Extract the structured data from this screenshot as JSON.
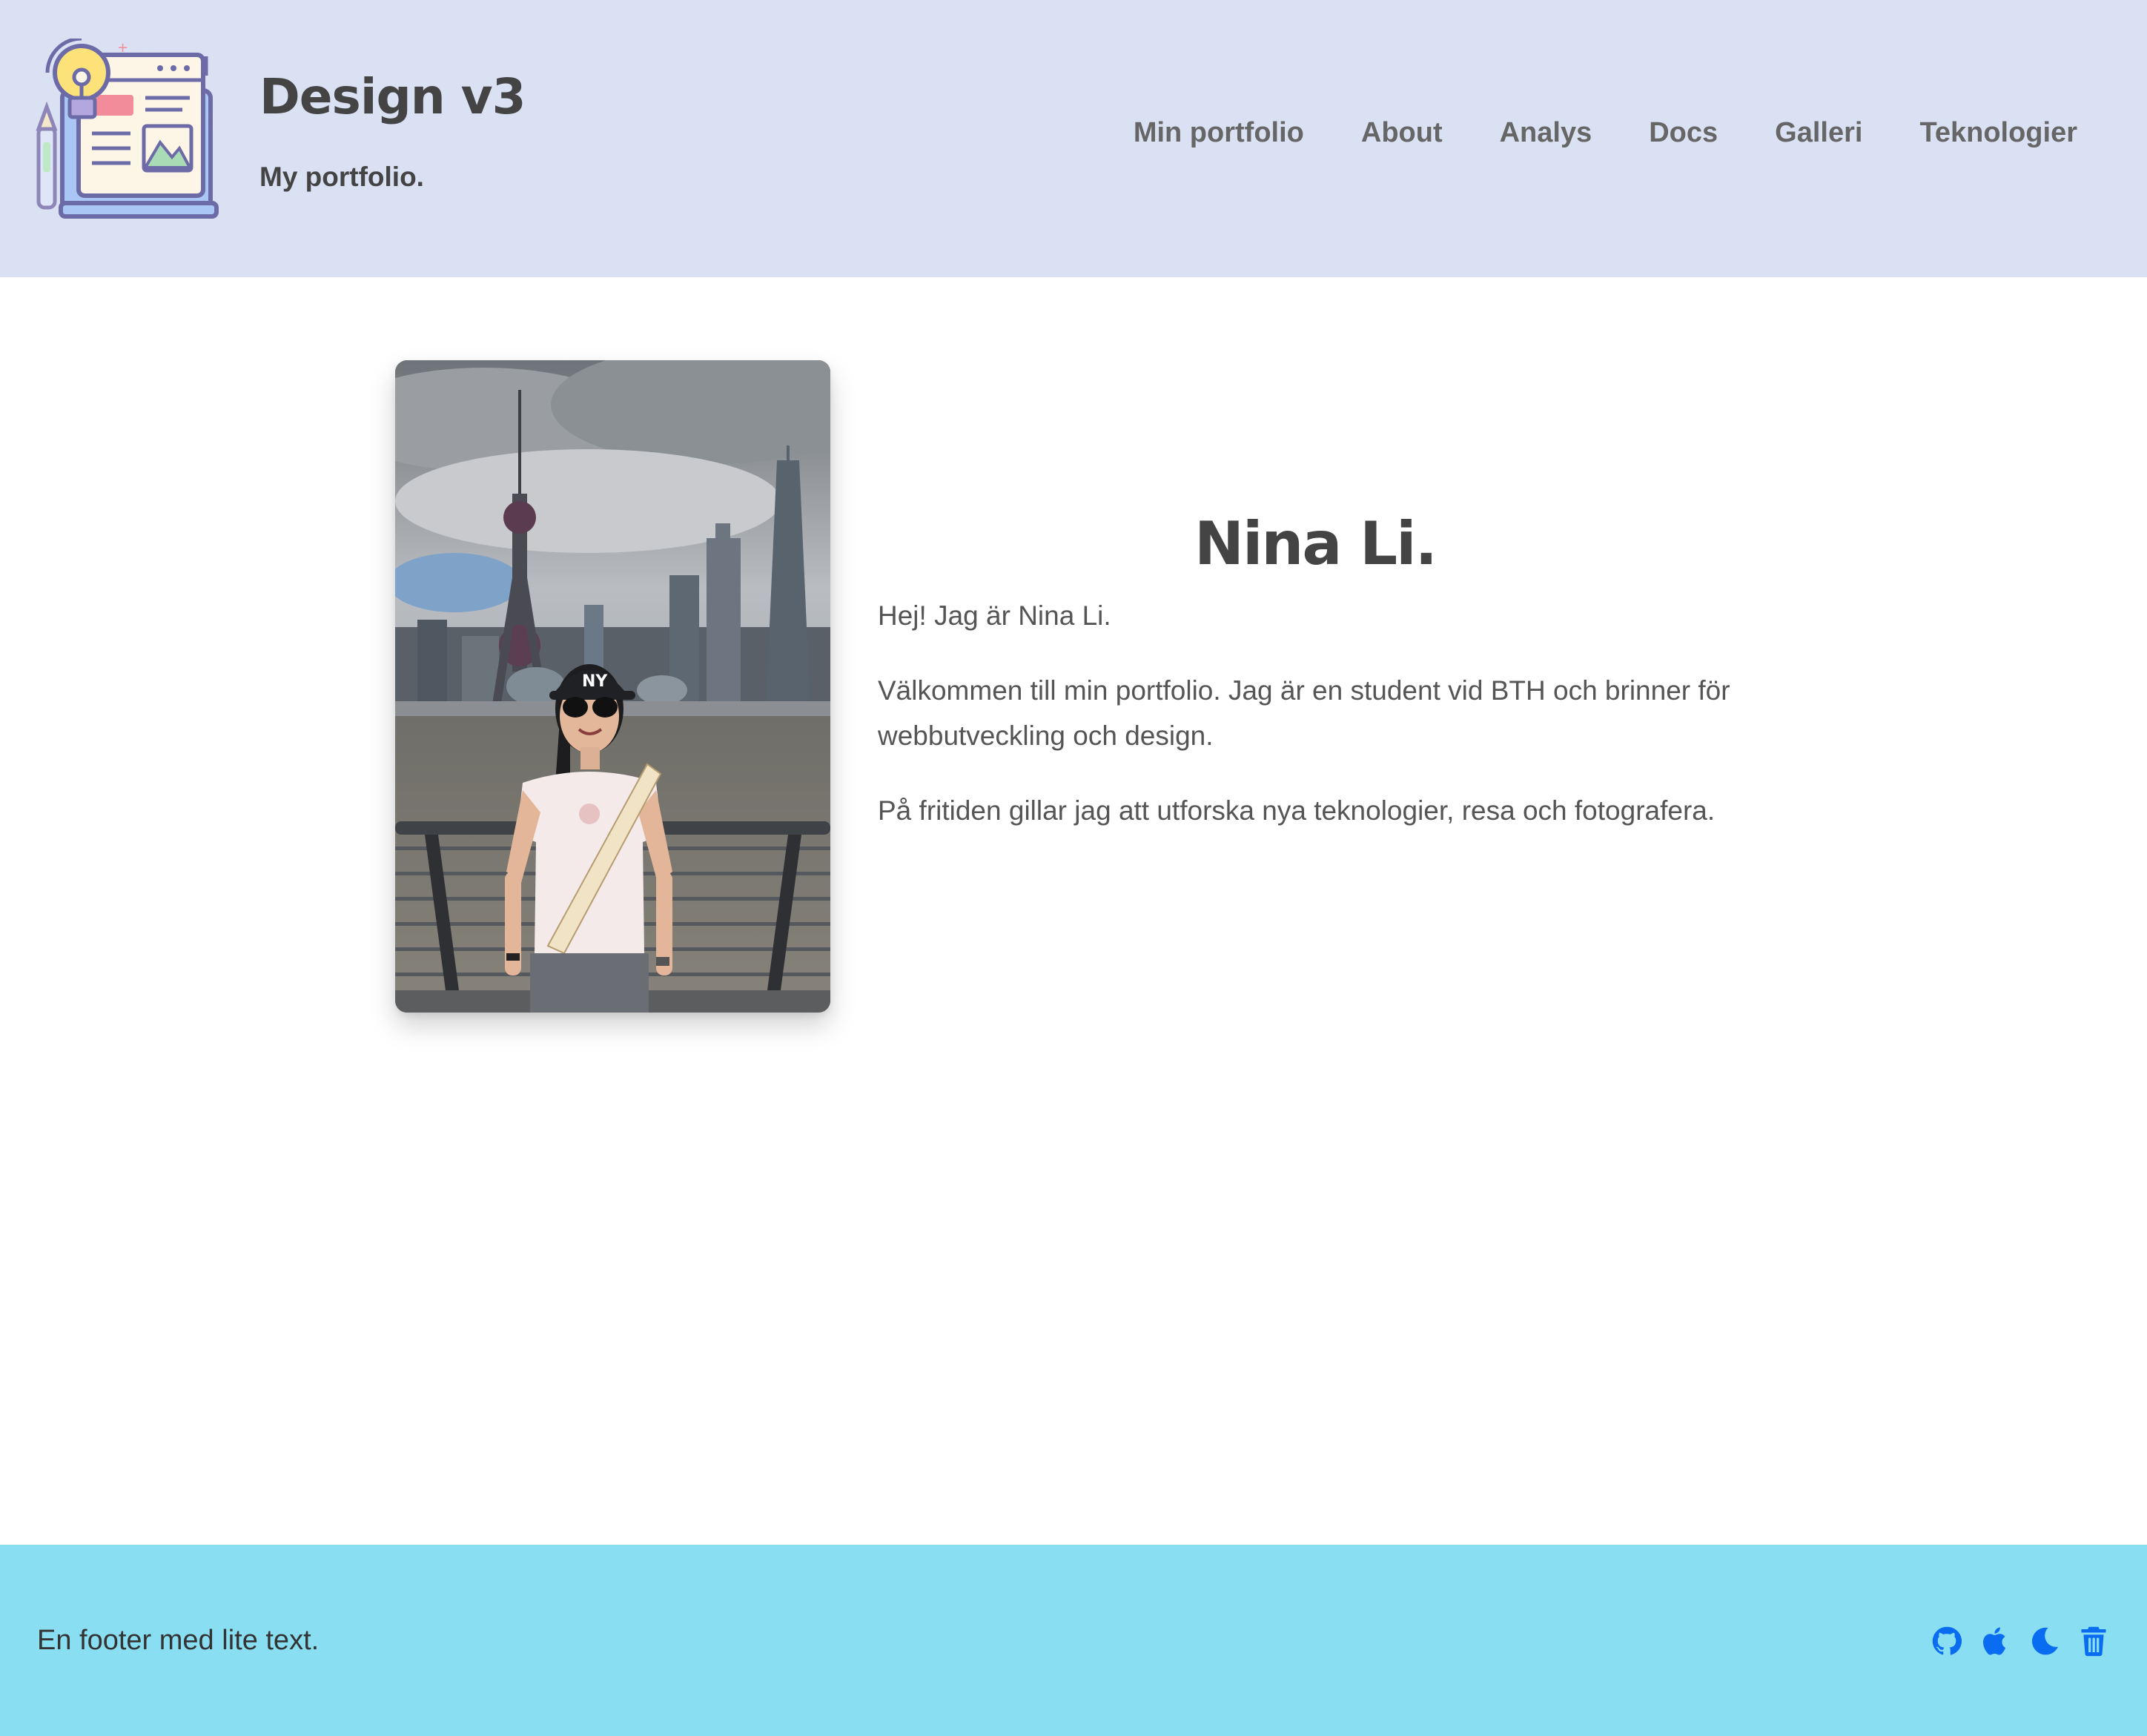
{
  "header": {
    "title": "Design v3",
    "slogan": "My portfolio.",
    "logo_icon": "web-design-illustration-icon",
    "nav": [
      {
        "label": "Min portfolio"
      },
      {
        "label": "About"
      },
      {
        "label": "Analys"
      },
      {
        "label": "Docs"
      },
      {
        "label": "Galleri"
      },
      {
        "label": "Teknologier"
      }
    ]
  },
  "main": {
    "portrait_alt": "Nina Li",
    "heading": "Nina Li.",
    "paragraphs": [
      "Hej! Jag är Nina Li.",
      "Välkommen till min portfolio. Jag är en student vid BTH och brinner för webbutveckling och design.",
      "På fritiden gillar jag att utforska nya teknologier, resa och fotografera."
    ]
  },
  "footer": {
    "text": "En footer med lite text.",
    "icons": [
      "github-icon",
      "apple-icon",
      "moon-icon",
      "trash-icon"
    ],
    "icon_color": "#0a6cf0"
  },
  "colors": {
    "header_bg": "#dae1f3",
    "footer_bg": "#89dff1",
    "text": "#444444",
    "nav_text": "#666666"
  }
}
